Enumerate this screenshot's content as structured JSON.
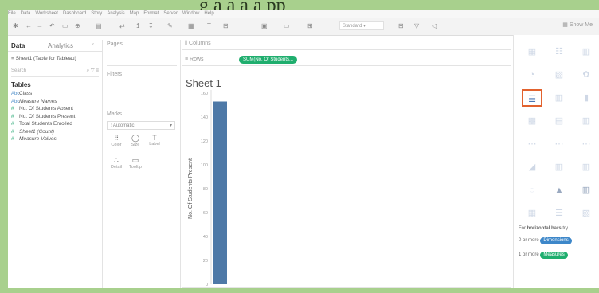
{
  "banner_text": "g a   a   a   a pp",
  "menu": [
    "File",
    "Data",
    "Worksheet",
    "Dashboard",
    "Story",
    "Analysis",
    "Map",
    "Format",
    "Server",
    "Window",
    "Help"
  ],
  "toolbar": {
    "fit": "Standard",
    "show_me_label": "Show Me"
  },
  "data_pane": {
    "tabs": [
      "Data",
      "Analytics"
    ],
    "datasource": "Sheet1 (Table for Tableau)",
    "search_placeholder": "Search",
    "tables_heading": "Tables",
    "fields": [
      {
        "name": "Class",
        "kind": "dimension",
        "italic": false
      },
      {
        "name": "Measure Names",
        "kind": "dimension",
        "italic": true
      },
      {
        "name": "No. Of Students Absent",
        "kind": "measure",
        "italic": false
      },
      {
        "name": "No. Of Students Present",
        "kind": "measure",
        "italic": false
      },
      {
        "name": "Total Students Enrolled",
        "kind": "measure",
        "italic": false
      },
      {
        "name": "Sheet1 (Count)",
        "kind": "measure",
        "italic": true
      },
      {
        "name": "Measure Values",
        "kind": "measure",
        "italic": true
      }
    ]
  },
  "cards": {
    "pages": "Pages",
    "filters": "Filters",
    "marks": "Marks",
    "mark_type": "Automatic"
  },
  "mark_buttons": [
    {
      "glyph": "⠿",
      "label": "Color"
    },
    {
      "glyph": "◯",
      "label": "Size"
    },
    {
      "glyph": "T",
      "label": "Label"
    },
    {
      "glyph": "∴",
      "label": "Detail"
    },
    {
      "glyph": "▭",
      "label": "Tooltip"
    }
  ],
  "shelves": {
    "columns_label": "Columns",
    "rows_label": "Rows",
    "rows_pill": "SUM(No. Of Students..."
  },
  "sheet_title": "Sheet 1",
  "chart_data": {
    "type": "bar",
    "categories": [
      ""
    ],
    "values": [
      153
    ],
    "ylabel": "No. Of Students Present",
    "xlabel": "",
    "title": "",
    "ylim": [
      0,
      160
    ],
    "yticks": [
      0,
      20,
      40,
      60,
      80,
      100,
      120,
      140,
      160
    ],
    "bar_color": "#4e79a7"
  },
  "show_me": {
    "hint_prefix": "For",
    "hint_bold": "horizontal bars",
    "hint_suffix": "try",
    "req1_prefix": "0 or more",
    "req1_pill": "Dimensions",
    "req2_prefix": "1 or more",
    "req2_pill": "Measures",
    "dim_color": "#3d87c9",
    "mea_color": "#1fae6e"
  }
}
